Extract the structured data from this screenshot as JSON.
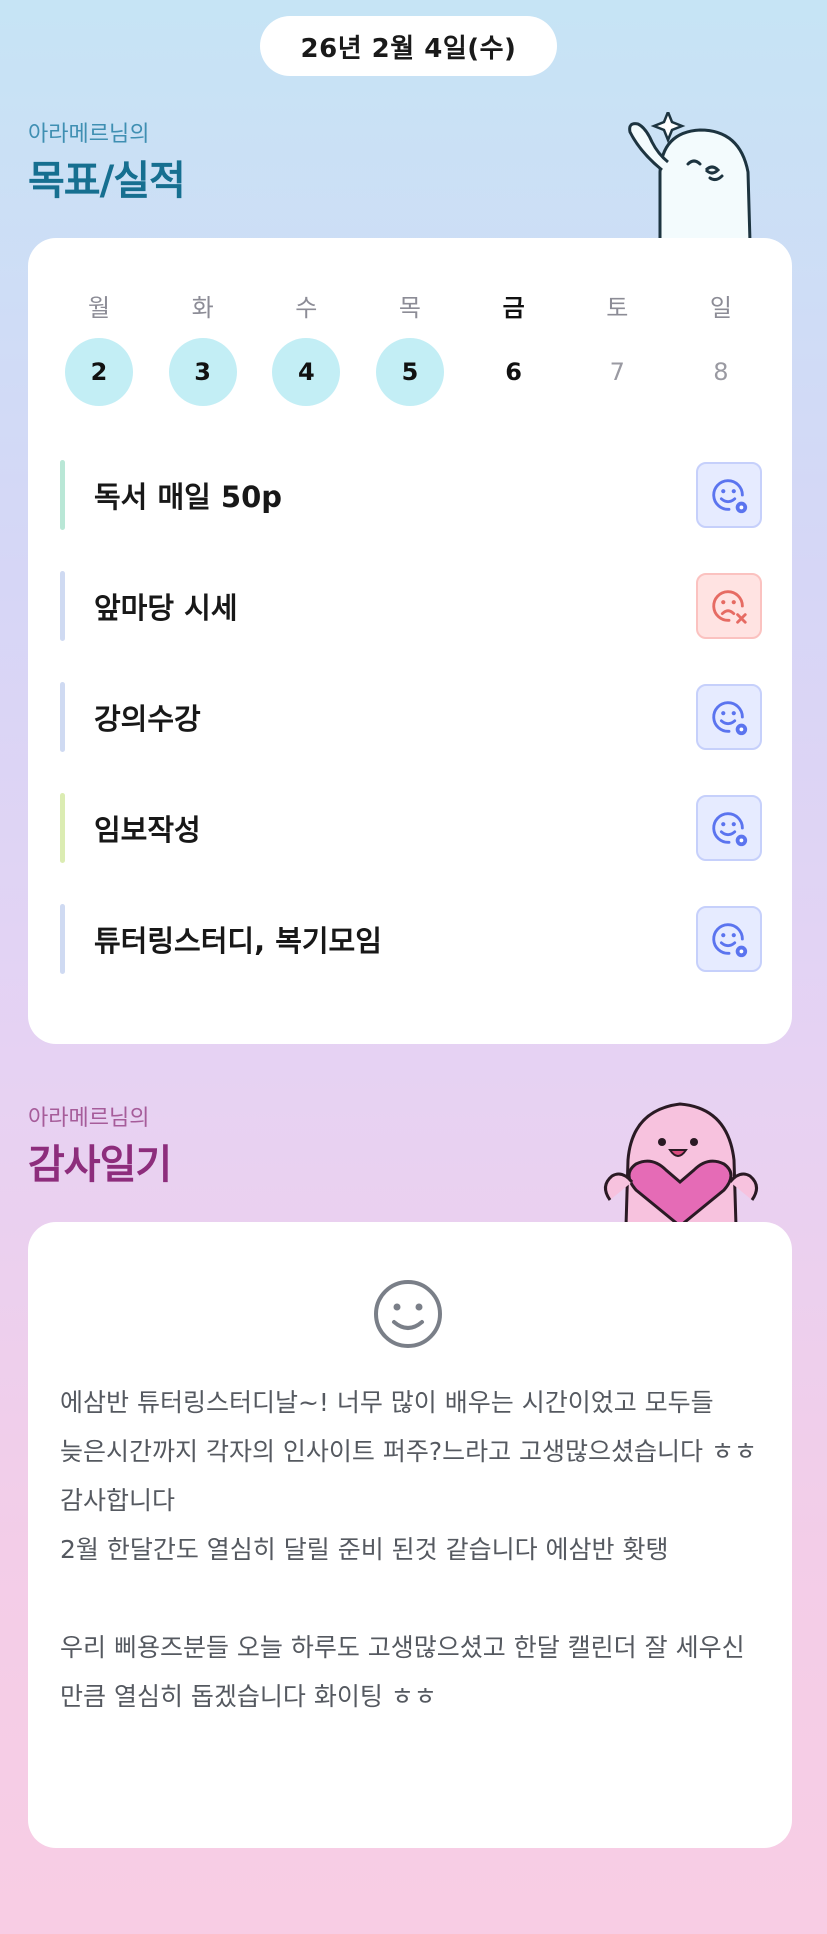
{
  "header": {
    "date": "26년 2월 4일(수)"
  },
  "goal_section": {
    "owner_label": "아라메르님의",
    "title": "목표/실적"
  },
  "week": [
    {
      "name": "월",
      "num": "2",
      "state": "done"
    },
    {
      "name": "화",
      "num": "3",
      "state": "done"
    },
    {
      "name": "수",
      "num": "4",
      "state": "done"
    },
    {
      "name": "목",
      "num": "5",
      "state": "done"
    },
    {
      "name": "금",
      "num": "6",
      "state": "today"
    },
    {
      "name": "토",
      "num": "7",
      "state": "future"
    },
    {
      "name": "일",
      "num": "8",
      "state": "future"
    }
  ],
  "goals": [
    {
      "text": "독서 매일 50p",
      "status": "success",
      "bar_color": "#b9e7d6",
      "icon": "smile-check-icon"
    },
    {
      "text": "앞마당 시세",
      "status": "fail",
      "bar_color": "#cfdaf2",
      "icon": "sad-x-icon"
    },
    {
      "text": "강의수강",
      "status": "success",
      "bar_color": "#cfdaf2",
      "icon": "smile-check-icon"
    },
    {
      "text": "임보작성",
      "status": "success",
      "bar_color": "#dbecb2",
      "icon": "smile-check-icon"
    },
    {
      "text": "튜터링스터디, 복기모임",
      "status": "success",
      "bar_color": "#cfdaf2",
      "icon": "smile-check-icon"
    }
  ],
  "thanks_section": {
    "owner_label": "아라메르님의",
    "title": "감사일기",
    "mood_icon": "smile-face-icon",
    "diary_text": "에삼반 튜터링스터디날~! 너무 많이 배우는 시간이었고 모두들 늦은시간까지 각자의 인사이트 퍼주?느라고 고생많으셨습니다 ㅎㅎ 감사합니다\n2월 한달간도 열심히 달릴 준비 된것 같습니다 에삼반 홧탱\n\n우리 삐용즈분들 오늘 하루도 고생많으셨고 한달 캘린더 잘 세우신 만큼 열심히 돕겠습니다 화이팅 ㅎㅎ"
  },
  "colors": {
    "goal_title": "#166f90",
    "thanks_title": "#8d2d7c",
    "done_day_bg": "#c3eef5",
    "success_icon": "#5b74ef",
    "fail_icon": "#e66b63"
  }
}
